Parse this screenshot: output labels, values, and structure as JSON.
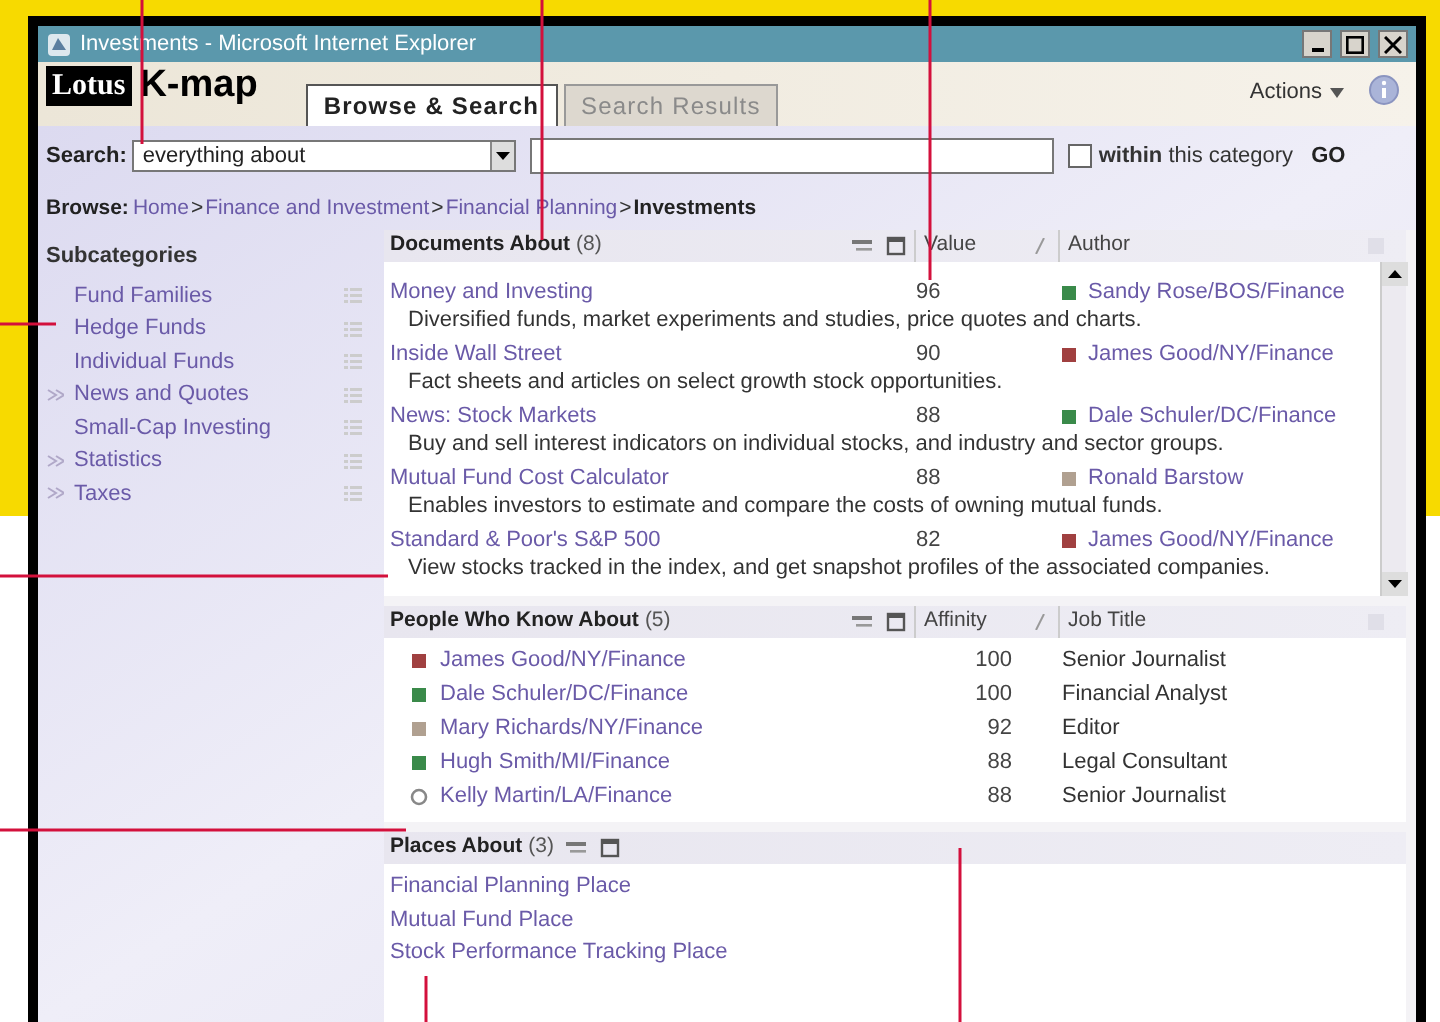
{
  "window": {
    "title": "Investments - Microsoft Internet Explorer"
  },
  "header": {
    "logo": "Lotus",
    "app_name": "K-map",
    "actions": "Actions"
  },
  "tabs": [
    {
      "label": "Browse & Search",
      "selected": true,
      "disabled": false
    },
    {
      "label": "Search Results",
      "selected": false,
      "disabled": true
    }
  ],
  "search": {
    "label": "Search:",
    "scope": "everything about",
    "within_checked": false,
    "within_label": "**within** this category",
    "go": "GO"
  },
  "breadcrumb": {
    "label": "Browse:",
    "items": [
      {
        "text": "Home",
        "current": false
      },
      {
        "sep": ">",
        "text": "Finance and Investment",
        "current": false
      },
      {
        "sep": ">",
        "text": "Financial Planning",
        "current": false
      },
      {
        "sep": ">",
        "text": "Investments",
        "current": true
      }
    ]
  },
  "subcategories": {
    "title": "Subcategories",
    "items": [
      {
        "label": "Fund Families",
        "expandable": false
      },
      {
        "label": "Hedge Funds",
        "expandable": false
      },
      {
        "label": "Individual Funds",
        "expandable": false
      },
      {
        "label": "News and Quotes",
        "expandable": true
      },
      {
        "label": "Small-Cap Investing",
        "expandable": false
      },
      {
        "label": "Statistics",
        "expandable": true
      },
      {
        "label": "Taxes",
        "expandable": true
      }
    ]
  },
  "documents": {
    "title": "Documents About",
    "count": "(8)",
    "columns": [
      "Value",
      "Author"
    ],
    "rows": [
      {
        "title": "Money and Investing",
        "value": "96",
        "author": "Sandy Rose/BOS/Finance",
        "color": "#3a8a4a",
        "description": "Diversified funds, market experiments and studies, price quotes and charts."
      },
      {
        "title": "Inside Wall Street",
        "value": "90",
        "author": "James Good/NY/Finance",
        "color": "#a04040",
        "description": "Fact sheets and articles on select growth stock opportunities."
      },
      {
        "title": "News: Stock Markets",
        "value": "88",
        "author": "Dale Schuler/DC/Finance",
        "color": "#3a8a4a",
        "description": "Buy and sell interest indicators on individual stocks, and industry and sector groups."
      },
      {
        "title": "Mutual Fund Cost Calculator",
        "value": "88",
        "author": "Ronald Barstow",
        "color": "#b0a090",
        "description": "Enables investors to estimate and compare the costs of owning mutual funds."
      },
      {
        "title": "Standard & Poor's S&P 500",
        "value": "82",
        "author": "James Good/NY/Finance",
        "color": "#a04040",
        "description": "View stocks tracked in the index, and get snapshot profiles of the associated companies."
      }
    ]
  },
  "people": {
    "title": "People Who Know About",
    "count": "(5)",
    "columns": [
      "Affinity",
      "Job Title"
    ],
    "rows": [
      {
        "name": "James Good/NY/Finance",
        "color": "#a04040",
        "affinity": "100",
        "job_title": "Senior Journalist"
      },
      {
        "name": "Dale Schuler/DC/Finance",
        "color": "#3a8a4a",
        "affinity": "100",
        "job_title": "Financial Analyst"
      },
      {
        "name": "Mary Richards/NY/Finance",
        "color": "#b0a090",
        "affinity": "92",
        "job_title": "Editor"
      },
      {
        "name": "Hugh Smith/MI/Finance",
        "color": "#3a8a4a",
        "affinity": "88",
        "job_title": "Legal Consultant"
      },
      {
        "name": "Kelly Martin/LA/Finance",
        "color": "#888888",
        "affinity": "88",
        "job_title": "Senior Journalist"
      }
    ]
  },
  "places": {
    "title": "Places About",
    "count": "(3)",
    "items": [
      "Financial Planning Place",
      "Mutual Fund Place",
      "Stock Performance Tracking Place"
    ]
  }
}
